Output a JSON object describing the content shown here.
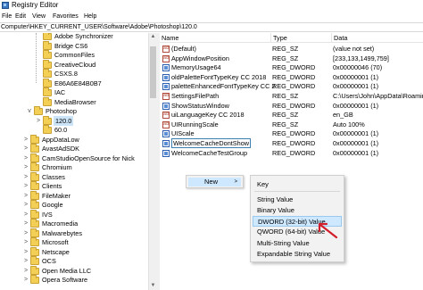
{
  "window": {
    "title": "Registry Editor"
  },
  "menu": {
    "items": [
      "File",
      "Edit",
      "View",
      "Favorites",
      "Help"
    ]
  },
  "address": {
    "path": "Computer\\HKEY_CURRENT_USER\\Software\\Adobe\\Photoshop\\120.0"
  },
  "tree": {
    "items": [
      {
        "label": "Adobe Synchronizer",
        "expander": ""
      },
      {
        "label": "Bridge CS6",
        "expander": ""
      },
      {
        "label": "CommonFiles",
        "expander": ""
      },
      {
        "label": "CreativeCloud",
        "expander": ""
      },
      {
        "label": "CSXS.8",
        "expander": ""
      },
      {
        "label": "E86A6E84B0B7",
        "expander": ""
      },
      {
        "label": "IAC",
        "expander": ""
      },
      {
        "label": "MediaBrowser",
        "expander": ""
      },
      {
        "label": "Photoshop",
        "expander": "v"
      },
      {
        "label": "120.0",
        "expander": ">"
      },
      {
        "label": "60.0",
        "expander": ""
      },
      {
        "label": "AppDataLow",
        "expander": ">"
      },
      {
        "label": "AvastAdSDK",
        "expander": ">"
      },
      {
        "label": "CamStudioOpenSource for Nick",
        "expander": ">"
      },
      {
        "label": "Chromium",
        "expander": ">"
      },
      {
        "label": "Classes",
        "expander": ">"
      },
      {
        "label": "Clients",
        "expander": ">"
      },
      {
        "label": "FileMaker",
        "expander": ">"
      },
      {
        "label": "Google",
        "expander": ">"
      },
      {
        "label": "IVS",
        "expander": ">"
      },
      {
        "label": "Macromedia",
        "expander": ">"
      },
      {
        "label": "Malwarebytes",
        "expander": ">"
      },
      {
        "label": "Microsoft",
        "expander": ">"
      },
      {
        "label": "Netscape",
        "expander": ">"
      },
      {
        "label": "OCS",
        "expander": ">"
      },
      {
        "label": "Open Media LLC",
        "expander": ">"
      },
      {
        "label": "Opera Software",
        "expander": ">"
      }
    ]
  },
  "list": {
    "headers": {
      "name": "Name",
      "type": "Type",
      "data": "Data"
    },
    "rows": [
      {
        "name": "(Default)",
        "type": "REG_SZ",
        "data": "(value not set)",
        "kind": "sz"
      },
      {
        "name": "AppWindowPosition",
        "type": "REG_SZ",
        "data": "[233,133,1499,759]",
        "kind": "sz"
      },
      {
        "name": "MemoryUsage64",
        "type": "REG_DWORD",
        "data": "0x00000046 (70)",
        "kind": "dw"
      },
      {
        "name": "oldPaletteFontTypeKey CC 2018",
        "type": "REG_DWORD",
        "data": "0x00000001 (1)",
        "kind": "dw"
      },
      {
        "name": "paletteEnhancedFontTypeKey CC 2...",
        "type": "REG_DWORD",
        "data": "0x00000001 (1)",
        "kind": "dw"
      },
      {
        "name": "SettingsFilePath",
        "type": "REG_SZ",
        "data": "C:\\Users\\John\\AppData\\Roaming",
        "kind": "sz"
      },
      {
        "name": "ShowStatusWindow",
        "type": "REG_DWORD",
        "data": "0x00000001 (1)",
        "kind": "dw"
      },
      {
        "name": "uiLanguageKey CC 2018",
        "type": "REG_SZ",
        "data": "en_GB",
        "kind": "sz"
      },
      {
        "name": "UIRunningScale",
        "type": "REG_SZ",
        "data": "Auto 100%",
        "kind": "sz"
      },
      {
        "name": "UIScale",
        "type": "REG_DWORD",
        "data": "0x00000001 (1)",
        "kind": "dw"
      },
      {
        "name": "WelcomeCacheDontShow",
        "type": "REG_DWORD",
        "data": "0x00000001 (1)",
        "kind": "dw"
      },
      {
        "name": "WelcomeCacheTestGroup",
        "type": "REG_DWORD",
        "data": "0x00000001 (1)",
        "kind": "dw"
      }
    ]
  },
  "context_menu": {
    "new_label": "New",
    "arrow": ">"
  },
  "submenu": {
    "items": [
      {
        "label": "Key"
      },
      {
        "label": "String Value"
      },
      {
        "label": "Binary Value"
      },
      {
        "label": "DWORD (32-bit) Value"
      },
      {
        "label": "QWORD (64-bit) Value"
      },
      {
        "label": "Multi-String Value"
      },
      {
        "label": "Expandable String Value"
      }
    ],
    "highlighted_index": 3
  },
  "colors": {
    "selection": "#cce4f7",
    "menu_highlight": "#cde8ff",
    "arrow": "#d21f2b",
    "folder": "#f3cf55"
  }
}
